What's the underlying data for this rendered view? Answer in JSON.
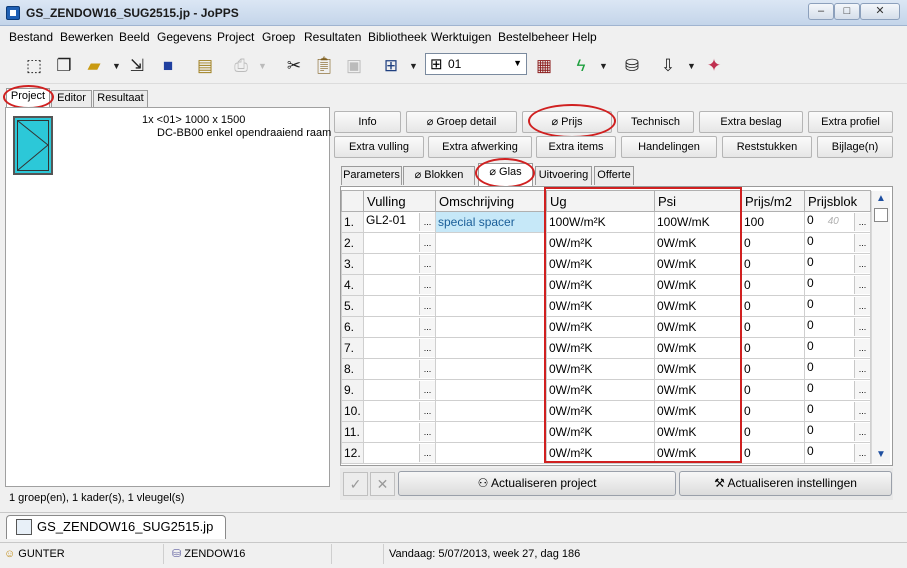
{
  "window": {
    "title": "GS_ZENDOW16_SUG2515.jp - JoPPS"
  },
  "menu": [
    "Bestand",
    "Bewerken",
    "Beeld",
    "Gegevens",
    "Project",
    "Groep",
    "Resultaten",
    "Bibliotheek",
    "Werktuigen",
    "Bestelbeheer",
    "Help"
  ],
  "toolbar": {
    "combo_value": "01"
  },
  "left_tabs": [
    "Project",
    "Editor",
    "Resultaat"
  ],
  "project_item": {
    "line1": "1x <01> 1000 x 1500",
    "line2": "DC-BB00 enkel opendraaiend raam"
  },
  "left_status": "1 groep(en), 1 kader(s), 1 vleugel(s)",
  "buttons_row1": [
    "Info",
    "Groep detail",
    "Prijs",
    "Technisch",
    "Extra beslag",
    "Extra profiel"
  ],
  "buttons_row2": [
    "Extra vulling",
    "Extra afwerking",
    "Extra items",
    "Handelingen",
    "Reststukken",
    "Bijlage(n)"
  ],
  "sub_tabs": [
    "Parameters",
    "Blokken",
    "Glas",
    "Uitvoering",
    "Offerte"
  ],
  "grid": {
    "columns": [
      "",
      "Vulling",
      "Omschrijving",
      "Ug",
      "Psi",
      "Prijs/m2",
      "Prijsblok"
    ],
    "rows": [
      {
        "n": "1.",
        "vulling": "GL2-01",
        "omschrijving": "special spacer",
        "ug": "100W/m²K",
        "psi": "100W/mK",
        "prijs": "100",
        "blok": "0",
        "ghost": "40"
      },
      {
        "n": "2.",
        "vulling": "",
        "omschrijving": "",
        "ug": "0W/m²K",
        "psi": "0W/mK",
        "prijs": "0",
        "blok": "0",
        "ghost": ""
      },
      {
        "n": "3.",
        "vulling": "",
        "omschrijving": "",
        "ug": "0W/m²K",
        "psi": "0W/mK",
        "prijs": "0",
        "blok": "0",
        "ghost": ""
      },
      {
        "n": "4.",
        "vulling": "",
        "omschrijving": "",
        "ug": "0W/m²K",
        "psi": "0W/mK",
        "prijs": "0",
        "blok": "0",
        "ghost": ""
      },
      {
        "n": "5.",
        "vulling": "",
        "omschrijving": "",
        "ug": "0W/m²K",
        "psi": "0W/mK",
        "prijs": "0",
        "blok": "0",
        "ghost": ""
      },
      {
        "n": "6.",
        "vulling": "",
        "omschrijving": "",
        "ug": "0W/m²K",
        "psi": "0W/mK",
        "prijs": "0",
        "blok": "0",
        "ghost": ""
      },
      {
        "n": "7.",
        "vulling": "",
        "omschrijving": "",
        "ug": "0W/m²K",
        "psi": "0W/mK",
        "prijs": "0",
        "blok": "0",
        "ghost": ""
      },
      {
        "n": "8.",
        "vulling": "",
        "omschrijving": "",
        "ug": "0W/m²K",
        "psi": "0W/mK",
        "prijs": "0",
        "blok": "0",
        "ghost": ""
      },
      {
        "n": "9.",
        "vulling": "",
        "omschrijving": "",
        "ug": "0W/m²K",
        "psi": "0W/mK",
        "prijs": "0",
        "blok": "0",
        "ghost": ""
      },
      {
        "n": "10.",
        "vulling": "",
        "omschrijving": "",
        "ug": "0W/m²K",
        "psi": "0W/mK",
        "prijs": "0",
        "blok": "0",
        "ghost": ""
      },
      {
        "n": "11.",
        "vulling": "",
        "omschrijving": "",
        "ug": "0W/m²K",
        "psi": "0W/mK",
        "prijs": "0",
        "blok": "0",
        "ghost": ""
      },
      {
        "n": "12.",
        "vulling": "",
        "omschrijving": "",
        "ug": "0W/m²K",
        "psi": "0W/mK",
        "prijs": "0",
        "blok": "0",
        "ghost": ""
      }
    ]
  },
  "actions": {
    "update_project": "Actualiseren project",
    "update_settings": "Actualiseren instellingen"
  },
  "doc_tab": "GS_ZENDOW16_SUG2515.jp",
  "statusbar": {
    "user": "GUNTER",
    "database": "ZENDOW16",
    "date_info": "Vandaag: 5/07/2013, week 27, dag 186"
  },
  "colors": {
    "annotation": "#d02020",
    "window_glass": "#2cc8d8",
    "selected_cell": "#c6e8f8"
  }
}
